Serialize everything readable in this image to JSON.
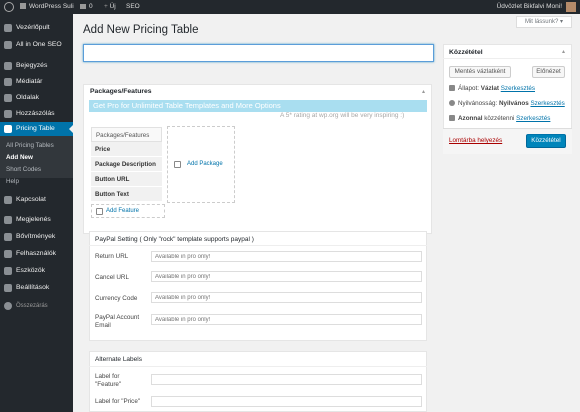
{
  "adminbar": {
    "site_name": "WordPress Suli",
    "comments_count": "0",
    "new_label": "Új",
    "seo_label": "SEO",
    "greeting": "Üdvözlet Bikfalvi Moni!"
  },
  "screen_options": "Mit lássunk?",
  "sidebar": {
    "items": [
      {
        "label": "Vezérlőpult",
        "icon": "dashboard-icon"
      },
      {
        "label": "All in One SEO",
        "icon": "seo-icon"
      },
      {
        "label": "Bejegyzés",
        "icon": "pin-icon"
      },
      {
        "label": "Médiatár",
        "icon": "media-icon"
      },
      {
        "label": "Oldalak",
        "icon": "page-icon"
      },
      {
        "label": "Hozzászólás",
        "icon": "comment-icon"
      },
      {
        "label": "Pricing Table",
        "icon": "table-icon"
      },
      {
        "label": "Kapcsolat",
        "icon": "mail-icon"
      },
      {
        "label": "Megjelenés",
        "icon": "brush-icon"
      },
      {
        "label": "Bővítmények",
        "icon": "plugin-icon"
      },
      {
        "label": "Felhasználók",
        "icon": "users-icon"
      },
      {
        "label": "Eszközök",
        "icon": "tools-icon"
      },
      {
        "label": "Beállítások",
        "icon": "settings-icon"
      },
      {
        "label": "Összezárás",
        "icon": "collapse-icon"
      }
    ],
    "submenu": [
      "All Pricing Tables",
      "Add New",
      "Short Codes",
      "Help"
    ]
  },
  "page_title": "Add New Pricing Table",
  "packages": {
    "heading": "Packages/Features",
    "pro_banner": "Get Pro for Unlimited Table Templates and More Options",
    "rating_text": "A 5* rating at wp.org will be very inspiring :)",
    "features": [
      "Packages/Features",
      "Price",
      "Package Description",
      "Button URL",
      "Button Text"
    ],
    "add_feature": "Add Feature",
    "add_package": "Add Package"
  },
  "paypal": {
    "heading": "PayPal Setting ( Only \"rock\" template supports paypal )",
    "fields": [
      {
        "label": "Return URL",
        "placeholder": "Available in pro only!"
      },
      {
        "label": "Cancel URL",
        "placeholder": "Available in pro only!"
      },
      {
        "label": "Currency Code",
        "placeholder": "Available in pro only!"
      },
      {
        "label": "PayPal Account Email",
        "placeholder": "Available in pro only!"
      }
    ]
  },
  "alternate": {
    "heading": "Alternate Labels",
    "fields": [
      {
        "label": "Label for \"Feature\""
      },
      {
        "label": "Label for \"Price\""
      }
    ]
  },
  "publish": {
    "heading": "Közzététel",
    "save_draft": "Mentés vázlatként",
    "preview": "Előnézet",
    "status_label": "Állapot:",
    "status_value": "Vázlat",
    "edit": "Szerkesztés",
    "visibility_label": "Nyilvánosság:",
    "visibility_value": "Nyilvános",
    "schedule_label": "Azonnal",
    "schedule_suffix": "közzétenni",
    "trash": "Lomtárba helyezés",
    "publish_btn": "Közzététel"
  },
  "colors": {
    "accent": "#0073aa",
    "adminbar": "#23282d",
    "banner": "#a9def0",
    "trash": "#a00"
  }
}
